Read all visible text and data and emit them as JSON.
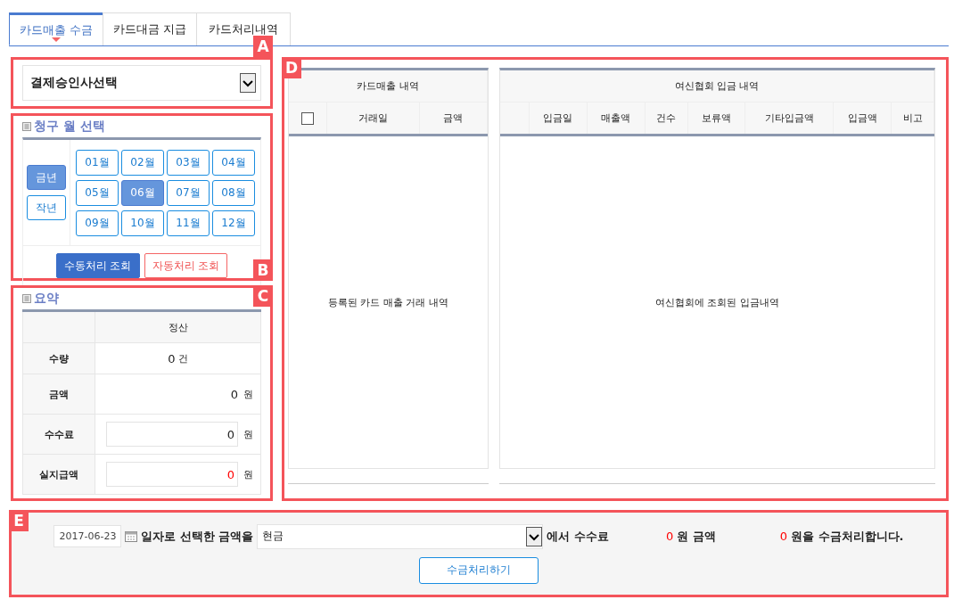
{
  "tabs": [
    {
      "label": "카드매출 수금",
      "selected": true
    },
    {
      "label": "카드대금 지급",
      "selected": false
    },
    {
      "label": "카드처리내역",
      "selected": false
    }
  ],
  "approver_select": {
    "callout": "A",
    "value": "결제승인사선택"
  },
  "month_select": {
    "callout": "B",
    "title": "청구 월 선택",
    "years": [
      {
        "label": "금년",
        "selected": true
      },
      {
        "label": "작년",
        "selected": false
      }
    ],
    "months": [
      {
        "label": "01월",
        "selected": false
      },
      {
        "label": "02월",
        "selected": false
      },
      {
        "label": "03월",
        "selected": false
      },
      {
        "label": "04월",
        "selected": false
      },
      {
        "label": "05월",
        "selected": false
      },
      {
        "label": "06월",
        "selected": true
      },
      {
        "label": "07월",
        "selected": false
      },
      {
        "label": "08월",
        "selected": false
      },
      {
        "label": "09월",
        "selected": false
      },
      {
        "label": "10월",
        "selected": false
      },
      {
        "label": "11월",
        "selected": false
      },
      {
        "label": "12월",
        "selected": false
      }
    ],
    "buttons": [
      {
        "label": "수동처리 조회",
        "kind": "primary"
      },
      {
        "label": "자동처리 조회",
        "kind": "danger"
      }
    ]
  },
  "summary": {
    "callout": "C",
    "title": "요약",
    "column_header": "정산",
    "rows": [
      {
        "label": "수량",
        "kind": "centered",
        "value": "0",
        "unit": "건",
        "color": "#222222"
      },
      {
        "label": "금액",
        "kind": "plain",
        "value": "0",
        "unit": "원",
        "color": "#222222"
      },
      {
        "label": "수수료",
        "kind": "input",
        "value": "0",
        "unit": "원",
        "color": "#222222"
      },
      {
        "label": "실지급액",
        "kind": "input",
        "value": "0",
        "unit": "원",
        "color": "#ff0000"
      }
    ]
  },
  "ledger": {
    "callout": "D",
    "card_sales": {
      "title": "카드매출 내역",
      "select_all": {
        "checked": false
      },
      "columns": [
        "거래일",
        "금액"
      ],
      "empty_text": "등록된 카드 매출 거래 내역"
    },
    "deposits": {
      "title": "여신협회 입금 내역",
      "columns": [
        "입금일",
        "매출액",
        "건수",
        "보류액",
        "기타입금액",
        "입금액",
        "비고"
      ],
      "empty_text": "여신협회에 조회된 입금내역"
    }
  },
  "collection": {
    "callout": "E",
    "date": "2017-06-23",
    "text_1": "일자로 선택한 금액을",
    "method": "현금",
    "text_2": "에서 수수료",
    "fee": "0",
    "text_3": "원 금액",
    "amount": "0",
    "text_4": "원을 수금처리합니다.",
    "button": "수금처리하기"
  }
}
